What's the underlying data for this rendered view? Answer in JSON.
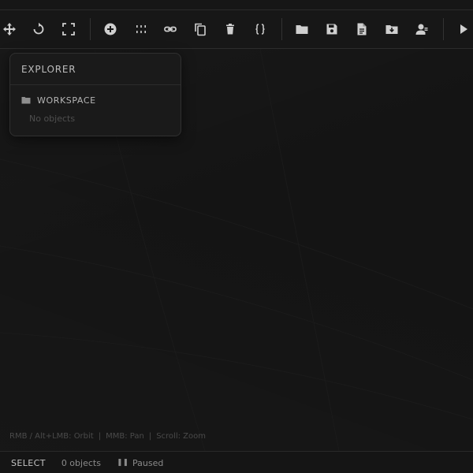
{
  "toolbar": {
    "buttons": [
      {
        "id": "move",
        "icon": "move-icon"
      },
      {
        "id": "rotate",
        "icon": "rotate-icon"
      },
      {
        "id": "scale",
        "icon": "scale-icon"
      },
      {
        "id": "add",
        "icon": "add-icon"
      },
      {
        "id": "distribute",
        "icon": "distribute-icon"
      },
      {
        "id": "link",
        "icon": "link-icon"
      },
      {
        "id": "duplicate",
        "icon": "duplicate-icon"
      },
      {
        "id": "delete",
        "icon": "delete-icon"
      },
      {
        "id": "code",
        "icon": "code-braces-icon"
      },
      {
        "id": "open",
        "icon": "folder-icon"
      },
      {
        "id": "save",
        "icon": "save-icon"
      },
      {
        "id": "new-file",
        "icon": "file-icon"
      },
      {
        "id": "import",
        "icon": "folder-download-icon"
      },
      {
        "id": "user",
        "icon": "user-icon"
      },
      {
        "id": "play",
        "icon": "play-icon"
      }
    ]
  },
  "explorer": {
    "title": "EXPLORER",
    "workspace_label": "WORKSPACE",
    "empty_text": "No objects"
  },
  "hint": {
    "orbit": "RMB / Alt+LMB: Orbit",
    "pan": "MMB: Pan",
    "zoom": "Scroll: Zoom",
    "separator": "|"
  },
  "status": {
    "mode": "SELECT",
    "object_count": "0 objects",
    "play_state": "Paused"
  }
}
